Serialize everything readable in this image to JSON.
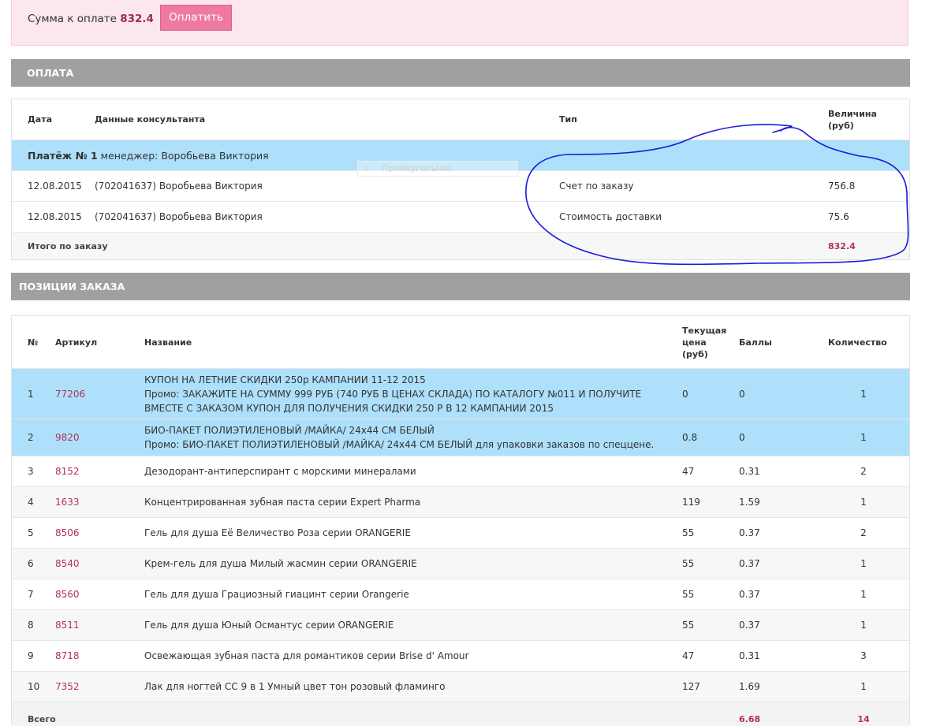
{
  "payment_box": {
    "label": "Сумма к оплате",
    "amount": "832.4",
    "button_label": "Оплатить"
  },
  "payment_section": {
    "title": "ОПЛАТА",
    "headers": {
      "date": "Дата",
      "consultant": "Данные консультанта",
      "type": "Тип",
      "amount": "Величина (руб)"
    },
    "group": {
      "label": "Платёж № 1",
      "manager": "менеджер: Воробьева Виктория"
    },
    "rows": [
      {
        "date": "12.08.2015",
        "consultant": "(702041637) Воробьева Виктория",
        "type": "Счет по заказу",
        "amount": "756.8"
      },
      {
        "date": "12.08.2015",
        "consultant": "(702041637) Воробьева Виктория",
        "type": "Стоимость доставки",
        "amount": "75.6"
      }
    ],
    "total": {
      "label": "Итого по заказу",
      "amount": "832.4"
    }
  },
  "ghost_tooltip": "Прямоугольник",
  "order_section": {
    "title": "ПОЗИЦИИ ЗАКАЗА",
    "headers": {
      "num": "№",
      "article": "Артикул",
      "name": "Название",
      "price": "Текущая цена (руб)",
      "points": "Баллы",
      "qty": "Количество"
    },
    "promo_items": [
      {
        "num": "1",
        "article": "77206",
        "name": "КУПОН НА ЛЕТНИЕ СКИДКИ 250р КАМПАНИИ 11-12 2015",
        "promo": "Промо: ЗАКАЖИТЕ НА СУММУ 999 РУБ (740 РУБ В ЦЕНАХ СКЛАДА) ПО КАТАЛОГУ №011 И ПОЛУЧИТЕ ВМЕСТЕ С ЗАКАЗОМ КУПОН ДЛЯ ПОЛУЧЕНИЯ СКИДКИ 250 Р В 12 КАМПАНИИ 2015",
        "price": "0",
        "points": "0",
        "qty": "1"
      },
      {
        "num": "2",
        "article": "9820",
        "name": "БИО-ПАКЕТ ПОЛИЭТИЛЕНОВЫЙ /МАЙКА/ 24x44 СМ БЕЛЫЙ",
        "promo": "Промо: БИО-ПАКЕТ ПОЛИЭТИЛЕНОВЫЙ /МАЙКА/ 24x44 СМ БЕЛЫЙ для упаковки заказов по спеццене.",
        "price": "0.8",
        "points": "0",
        "qty": "1"
      }
    ],
    "items": [
      {
        "num": "3",
        "article": "8152",
        "name": "Дезодорант-антиперспирант с морскими минералами",
        "price": "47",
        "points": "0.31",
        "qty": "2"
      },
      {
        "num": "4",
        "article": "1633",
        "name": "Концентрированная зубная паста серии Expert Pharma",
        "price": "119",
        "points": "1.59",
        "qty": "1"
      },
      {
        "num": "5",
        "article": "8506",
        "name": "Гель для душа Её Величество Роза серии ORANGERIE",
        "price": "55",
        "points": "0.37",
        "qty": "2"
      },
      {
        "num": "6",
        "article": "8540",
        "name": "Крем-гель для душа Милый жасмин серии ORANGERIE",
        "price": "55",
        "points": "0.37",
        "qty": "1"
      },
      {
        "num": "7",
        "article": "8560",
        "name": "Гель для душа Грациозный гиацинт серии Orangerie",
        "price": "55",
        "points": "0.37",
        "qty": "1"
      },
      {
        "num": "8",
        "article": "8511",
        "name": "Гель для душа Юный Османтус серии ORANGERIE",
        "price": "55",
        "points": "0.37",
        "qty": "1"
      },
      {
        "num": "9",
        "article": "8718",
        "name": "Освежающая зубная паста для романтиков серии Brise d' Amour",
        "price": "47",
        "points": "0.31",
        "qty": "3"
      },
      {
        "num": "10",
        "article": "7352",
        "name": "Лак для ногтей CC 9 в 1 Умный цвет тон розовый фламинго",
        "price": "127",
        "points": "1.69",
        "qty": "1"
      }
    ],
    "total": {
      "label": "Всего",
      "points": "6.68",
      "qty": "14"
    }
  },
  "colors": {
    "accent": "#ee7aa3",
    "link": "#b3305e",
    "header_bar": "#a0a0a0",
    "highlight_row": "#aee0fb",
    "pay_box_bg": "#fde7ee",
    "annotation_ink": "#1a1adb"
  }
}
